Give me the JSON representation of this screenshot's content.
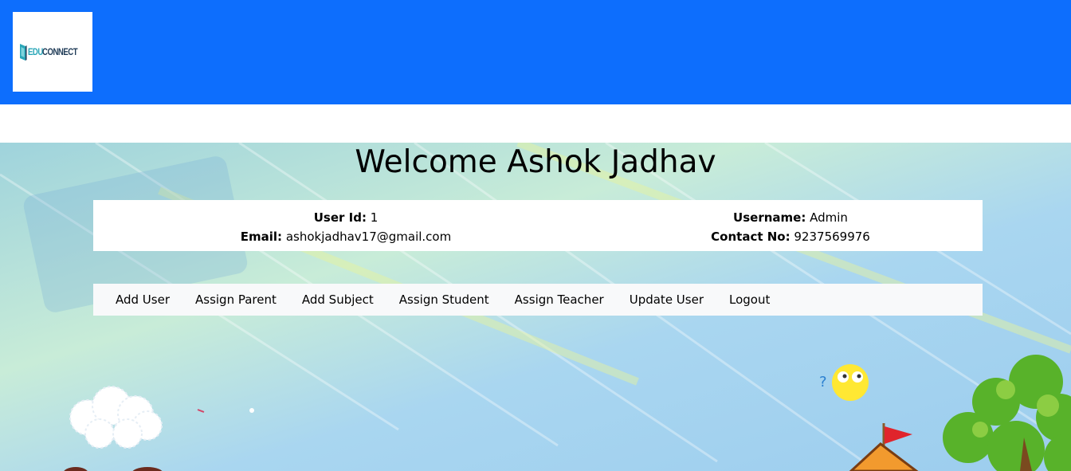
{
  "header": {
    "logo_edu": "EDU",
    "logo_connect": "CONNECT",
    "bar_color": "#0d6efd"
  },
  "welcome": {
    "title": "Welcome Ashok Jadhav"
  },
  "profile": {
    "user_id_label": "User Id:",
    "user_id_value": "1",
    "email_label": "Email:",
    "email_value": "ashokjadhav17@gmail.com",
    "username_label": "Username:",
    "username_value": "Admin",
    "contact_label": "Contact No:",
    "contact_value": "9237569976"
  },
  "nav": {
    "items": [
      {
        "label": "Add User"
      },
      {
        "label": "Assign Parent"
      },
      {
        "label": "Add Subject"
      },
      {
        "label": "Assign Student"
      },
      {
        "label": "Assign Teacher"
      },
      {
        "label": "Update User"
      },
      {
        "label": "Logout"
      }
    ]
  },
  "icons": {
    "logo": "book-icon",
    "emoji": "thinking-face-icon",
    "flag": "flag-icon"
  }
}
